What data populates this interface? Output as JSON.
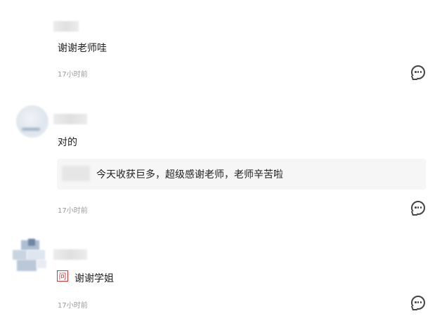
{
  "comments": [
    {
      "text": "谢谢老师哇",
      "time": "17小时前",
      "icon": "comment-icon"
    },
    {
      "text": "对的",
      "quote": "今天收获巨多，超级感谢老师，老师辛苦啦",
      "time": "17小时前",
      "icon": "comment-icon"
    },
    {
      "tag": "问",
      "text": "谢谢学姐",
      "time": "17小时前",
      "icon": "comment-icon"
    }
  ],
  "colors": {
    "tag": "#dd3333",
    "time": "#9a9a9a",
    "quote_bg": "#f6f6f6"
  }
}
